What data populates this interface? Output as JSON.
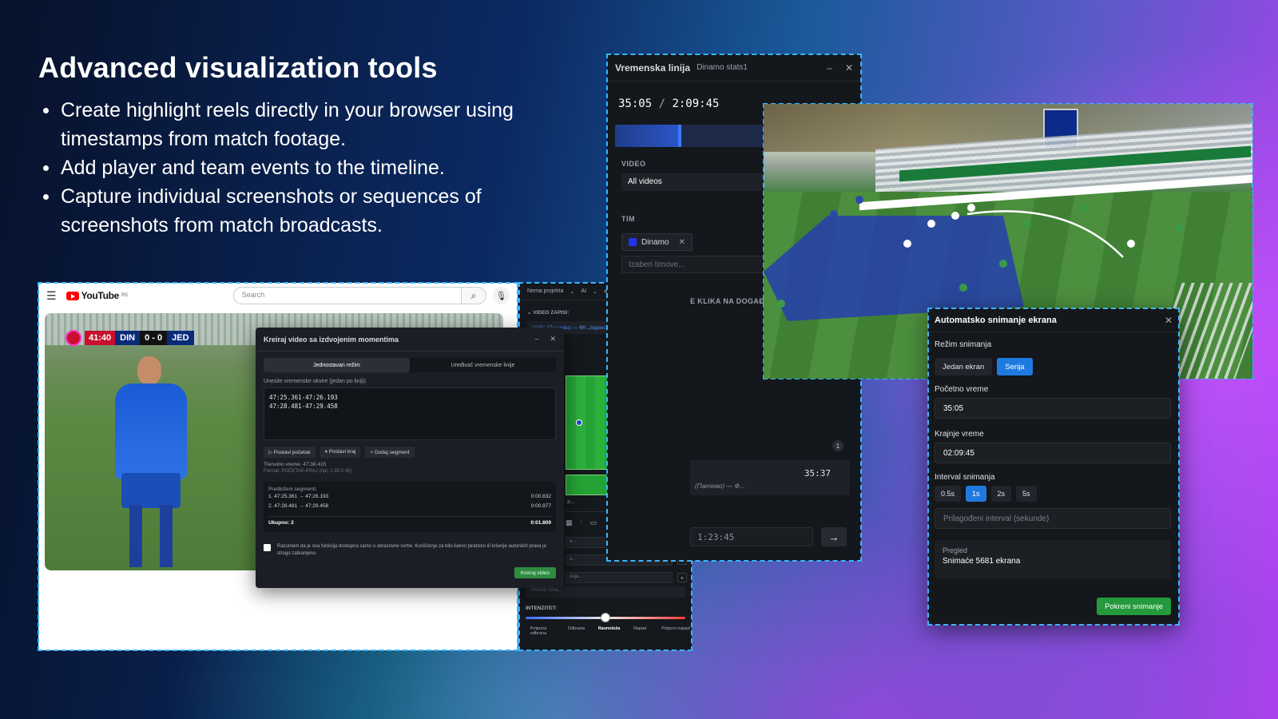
{
  "headline": {
    "title": "Advanced visualization tools",
    "bullets": [
      "Create highlight reels directly in your browser using timestamps from match footage.",
      "Add player and team events to the timeline.",
      "Capture individual screenshots or sequences of screenshots from match broadcasts."
    ]
  },
  "youtube": {
    "logo": "YouTube",
    "region": "RS",
    "search_placeholder": "Search",
    "scorebug": {
      "time": "41:40",
      "home": "DIN",
      "score": "0 - 0",
      "away": "JED"
    }
  },
  "kreiraj": {
    "title": "Kreiraj video sa izdvojenim momentima",
    "tabs": [
      "Jednostavan režim",
      "Uređivač vremenske linije"
    ],
    "frames_label": "Unesite vremenske okvire (jedan po liniji):",
    "frames": [
      "47:25.361-47:26.193",
      "47:28.481-47:29.458"
    ],
    "buttons": [
      "▷ Postavi početak",
      "⏸ Postavi kraj",
      "+ Dodaj segment"
    ],
    "current_time": "Trenutno vreme: 47:38.415",
    "format_hint": "Format: POČETAK-KRAJ (npr. 1:30-2:45)",
    "segments_label": "Predloženi segmenti:",
    "segments": [
      {
        "range": "1. 47:25.361 → 47:26.193",
        "dur": "0:00.832"
      },
      {
        "range": "2. 47:28.481 → 47:29.458",
        "dur": "0:00.977"
      }
    ],
    "total_label": "Ukupno: 2",
    "total_dur": "0:01.809",
    "disclaimer": "Razumem da je ova funkcija dostupna samo u obrazovne svrhe. Korišćenje za bilo kakvo piratstvo ili kršenje autorskih prava je strogo zabranjeno.",
    "create_label": "Kreiraj video"
  },
  "project_panel": {
    "project": "Nema projekta",
    "ai": "AI",
    "video_section": "VIDEO ZAPISI:",
    "video_chip": "1945\" (Панчево) — ФК „Јединство\" (С...",
    "input_partial": "a...",
    "search_zones": "Pretraži zone...",
    "field_partial_1": "e...",
    "field_partial_2": "a...",
    "field_partial_3": "daje...",
    "intensity_label": "INTENZITET:",
    "intensity_value": 0.5,
    "scale": [
      "Potpuna odbrana",
      "Odbrana",
      "Ravnoteža",
      "Napad",
      "Potpuni napad"
    ]
  },
  "timeline": {
    "title": "Vremenska linija",
    "subtitle": "Dinamo stats1",
    "time_current": "35:05",
    "time_total": "2:09:45",
    "progress": 0.27,
    "video_label": "VIDEO",
    "video_value": "All videos",
    "team_label": "TIM",
    "team_chip": "Dinamo",
    "team_placeholder": "Izaberi timove...",
    "click_label": "E KLIKA NA DOGAĐ",
    "badge_count": "1",
    "event_time": "35:37",
    "event_sub": "(Панчево) — Ф...",
    "seek_value": "1:23:45",
    "go_arrow": "→"
  },
  "auto_capture": {
    "title": "Automatsko snimanje ekrana",
    "mode_label": "Režim snimanja",
    "modes": [
      "Jedan ekran",
      "Serija"
    ],
    "active_mode": "Serija",
    "start_label": "Početno vreme",
    "start_value": "35:05",
    "end_label": "Krajnje vreme",
    "end_value": "02:09:45",
    "interval_label": "Interval snimanja",
    "intervals": [
      "0.5s",
      "1s",
      "2s",
      "5s"
    ],
    "active_interval": "1s",
    "custom_placeholder": "Prilagođeni interval (sekunde)",
    "preview_label": "Pregled",
    "preview_value": "Snimaće 5681 ekrana",
    "start_button": "Pokreni snimanje"
  },
  "colors": {
    "accent": "#1f7ae0",
    "success": "#249a3c",
    "dashed": "#38b6ff",
    "zone": "#2338b8"
  }
}
